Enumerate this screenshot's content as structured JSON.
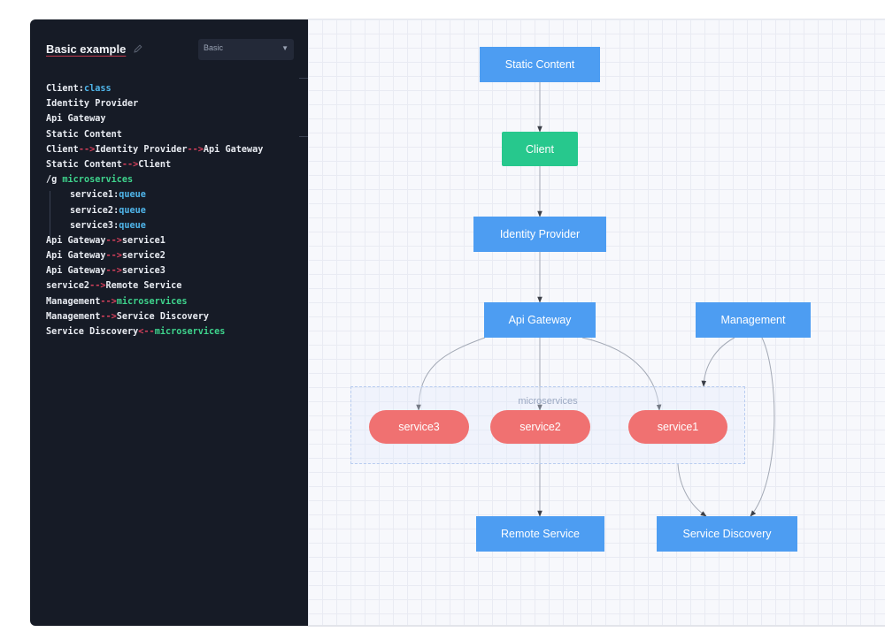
{
  "editor": {
    "title": "Basic example",
    "select_value": "Basic",
    "code_lines": [
      [
        {
          "t": "Client:",
          "c": "plain"
        },
        {
          "t": "class",
          "c": "kw"
        }
      ],
      [
        {
          "t": "Identity Provider",
          "c": "plain"
        }
      ],
      [
        {
          "t": "Api Gateway",
          "c": "plain"
        }
      ],
      [
        {
          "t": "Static Content",
          "c": "plain"
        }
      ],
      [
        {
          "t": "Client",
          "c": "plain"
        },
        {
          "t": "-->",
          "c": "arrow"
        },
        {
          "t": "Identity Provider",
          "c": "plain"
        },
        {
          "t": "-->",
          "c": "arrow"
        },
        {
          "t": "Api Gateway",
          "c": "plain"
        }
      ],
      [
        {
          "t": "Static Content",
          "c": "plain"
        },
        {
          "t": "-->",
          "c": "arrow"
        },
        {
          "t": "Client",
          "c": "plain"
        }
      ],
      [
        {
          "t": "/g ",
          "c": "plain"
        },
        {
          "t": "microservices",
          "c": "grp"
        }
      ],
      [
        {
          "t": "service1:",
          "c": "plain",
          "indent": true
        },
        {
          "t": "queue",
          "c": "kw"
        }
      ],
      [
        {
          "t": "service2:",
          "c": "plain",
          "indent": true
        },
        {
          "t": "queue",
          "c": "kw"
        }
      ],
      [
        {
          "t": "service3:",
          "c": "plain",
          "indent": true
        },
        {
          "t": "queue",
          "c": "kw"
        }
      ],
      [
        {
          "t": "Api Gateway",
          "c": "plain"
        },
        {
          "t": "-->",
          "c": "arrow"
        },
        {
          "t": "service1",
          "c": "plain"
        }
      ],
      [
        {
          "t": "Api Gateway",
          "c": "plain"
        },
        {
          "t": "-->",
          "c": "arrow"
        },
        {
          "t": "service2",
          "c": "plain"
        }
      ],
      [
        {
          "t": "Api Gateway",
          "c": "plain"
        },
        {
          "t": "-->",
          "c": "arrow"
        },
        {
          "t": "service3",
          "c": "plain"
        }
      ],
      [
        {
          "t": "service2",
          "c": "plain"
        },
        {
          "t": "-->",
          "c": "arrow"
        },
        {
          "t": "Remote Service",
          "c": "plain"
        }
      ],
      [
        {
          "t": "Management",
          "c": "plain"
        },
        {
          "t": "-->",
          "c": "arrow"
        },
        {
          "t": "microservices",
          "c": "grp"
        }
      ],
      [
        {
          "t": "Management",
          "c": "plain"
        },
        {
          "t": "-->",
          "c": "arrow"
        },
        {
          "t": "Service Discovery",
          "c": "plain"
        }
      ],
      [
        {
          "t": "Service Discovery",
          "c": "plain"
        },
        {
          "t": "<--",
          "c": "arrow"
        },
        {
          "t": "microservices",
          "c": "grp"
        }
      ]
    ]
  },
  "diagram": {
    "group_label": "microservices",
    "nodes": {
      "static_content": "Static Content",
      "client": "Client",
      "identity_provider": "Identity Provider",
      "api_gateway": "Api Gateway",
      "management": "Management",
      "service3": "service3",
      "service2": "service2",
      "service1": "service1",
      "remote_service": "Remote Service",
      "service_discovery": "Service Discovery"
    }
  },
  "colors": {
    "rect_node": "#4d9df2",
    "class_node": "#27c88d",
    "queue_node": "#f07171",
    "editor_bg": "#161b26",
    "arrow_token": "#d6405c",
    "keyword_token": "#4fb5ea",
    "group_token": "#3ed38c"
  }
}
